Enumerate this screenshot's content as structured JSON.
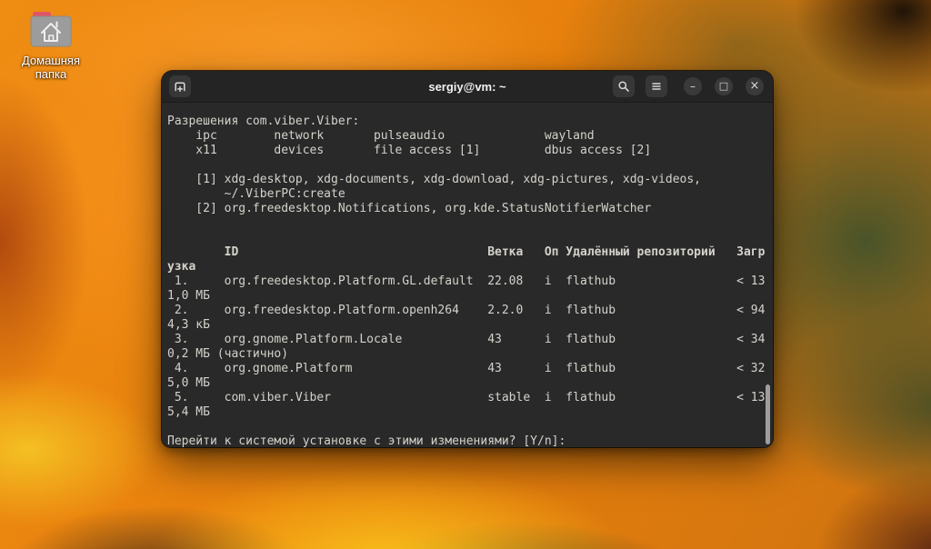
{
  "desktop": {
    "home_label": "Домашняя папка"
  },
  "window": {
    "title": "sergiy@vm: ~"
  },
  "icons": {
    "minimize_glyph": "–",
    "maximize_glyph": "□",
    "close_glyph": "×"
  },
  "colors": {
    "titlebar_bg": "#242424",
    "terminal_bg": "#292929",
    "terminal_text": "#d4d2cb",
    "wallpaper_base": "#e67e0c",
    "folder_tab": "#e25467"
  },
  "terminal": {
    "prompt_question": "Перейти к системой установке с этими изменениями? [Y/n]: ",
    "packages": [
      {
        "num": "1.",
        "id": "org.freedesktop.Platform.GL.default",
        "branch": "22.08",
        "op": "i",
        "remote": "flathub",
        "download": "< 131,0 МБ"
      },
      {
        "num": "2.",
        "id": "org.freedesktop.Platform.openh264",
        "branch": "2.2.0",
        "op": "i",
        "remote": "flathub",
        "download": "< 944,3 кБ"
      },
      {
        "num": "3.",
        "id": "org.gnome.Platform.Locale",
        "branch": "43",
        "op": "i",
        "remote": "flathub",
        "download": "< 340,2 МБ (частично)"
      },
      {
        "num": "4.",
        "id": "org.gnome.Platform",
        "branch": "43",
        "op": "i",
        "remote": "flathub",
        "download": "< 325,0 МБ"
      },
      {
        "num": "5.",
        "id": "com.viber.Viber",
        "branch": "stable",
        "op": "i",
        "remote": "flathub",
        "download": "< 135,4 МБ"
      }
    ],
    "lines": [
      {
        "text": "Разрешения com.viber.Viber:",
        "bold": false
      },
      {
        "text": "    ipc        network       pulseaudio              wayland",
        "bold": false
      },
      {
        "text": "    x11        devices       file access [1]         dbus access [2]",
        "bold": false
      },
      {
        "text": "",
        "bold": false
      },
      {
        "text": "    [1] xdg-desktop, xdg-documents, xdg-download, xdg-pictures, xdg-videos,",
        "bold": false
      },
      {
        "text": "        ~/.ViberPC:create",
        "bold": false
      },
      {
        "text": "    [2] org.freedesktop.Notifications, org.kde.StatusNotifierWatcher",
        "bold": false
      },
      {
        "text": "",
        "bold": false
      },
      {
        "text": "",
        "bold": false
      },
      {
        "text": "        ID                                   Ветка   Оп Удалённый репозиторий   Загр",
        "bold": true
      },
      {
        "text": "узка",
        "bold": true
      },
      {
        "text": " 1.     org.freedesktop.Platform.GL.default  22.08   i  flathub                 < 13",
        "bold": false
      },
      {
        "text": "1,0 МБ",
        "bold": false
      },
      {
        "text": " 2.     org.freedesktop.Platform.openh264    2.2.0   i  flathub                 < 94",
        "bold": false
      },
      {
        "text": "4,3 кБ",
        "bold": false
      },
      {
        "text": " 3.     org.gnome.Platform.Locale            43      i  flathub                 < 34",
        "bold": false
      },
      {
        "text": "0,2 МБ (частично)",
        "bold": false
      },
      {
        "text": " 4.     org.gnome.Platform                   43      i  flathub                 < 32",
        "bold": false
      },
      {
        "text": "5,0 МБ",
        "bold": false
      },
      {
        "text": " 5.     com.viber.Viber                      stable  i  flathub                 < 13",
        "bold": false
      },
      {
        "text": "5,4 МБ",
        "bold": false
      },
      {
        "text": "",
        "bold": false
      },
      {
        "text": "Перейти к системой установке с этими изменениями? [Y/n]: ",
        "bold": false
      }
    ]
  }
}
